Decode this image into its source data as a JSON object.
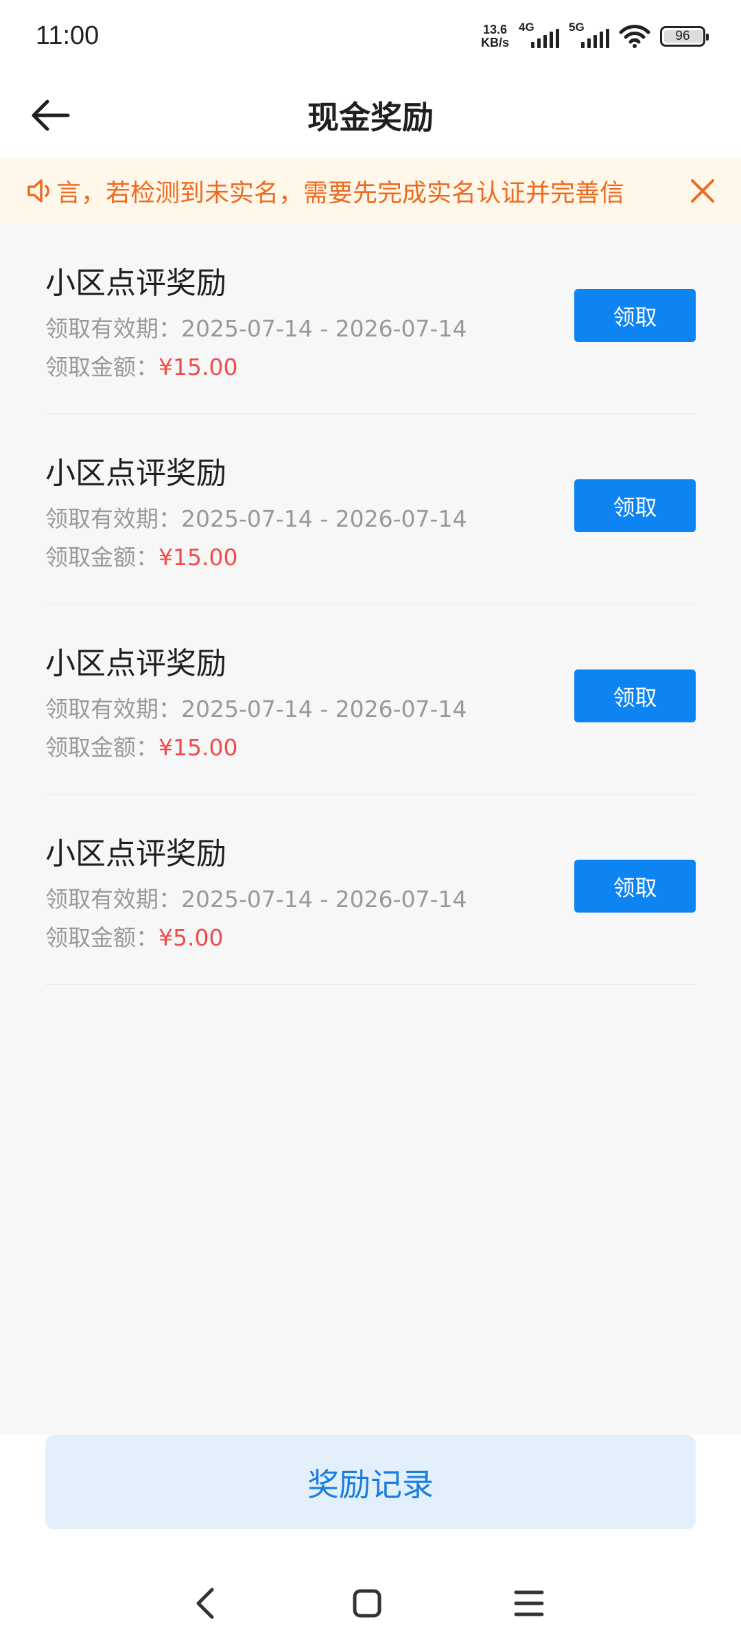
{
  "status_bar": {
    "time": "11:00",
    "net_speed_value": "13.6",
    "net_speed_unit": "KB/s",
    "sim1_label": "4G",
    "sim2_label": "5G",
    "battery_level": "96",
    "icons": [
      "signal-4g-icon",
      "signal-5g-icon",
      "wifi-icon",
      "battery-icon"
    ]
  },
  "header": {
    "title": "现金奖励",
    "back_icon": "arrow-left-icon"
  },
  "notice": {
    "icon": "speaker-icon",
    "text": "言，若检测到未实名，需要先完成实名认证并完善信",
    "close_icon": "close-icon"
  },
  "rewards": [
    {
      "title": "小区点评奖励",
      "validity_label": "领取有效期：",
      "validity": "2025-07-14 - 2026-07-14",
      "amount_label": "领取金额：",
      "amount": "¥15.00",
      "button_label": "领取"
    },
    {
      "title": "小区点评奖励",
      "validity_label": "领取有效期：",
      "validity": "2025-07-14 - 2026-07-14",
      "amount_label": "领取金额：",
      "amount": "¥15.00",
      "button_label": "领取"
    },
    {
      "title": "小区点评奖励",
      "validity_label": "领取有效期：",
      "validity": "2025-07-14 - 2026-07-14",
      "amount_label": "领取金额：",
      "amount": "¥15.00",
      "button_label": "领取"
    },
    {
      "title": "小区点评奖励",
      "validity_label": "领取有效期：",
      "validity": "2025-07-14 - 2026-07-14",
      "amount_label": "领取金额：",
      "amount": "¥5.00",
      "button_label": "领取"
    }
  ],
  "footer": {
    "records_button_label": "奖励记录"
  },
  "nav_bar": {
    "icons": [
      "nav-back-icon",
      "nav-home-icon",
      "nav-menu-icon"
    ]
  },
  "colors": {
    "accent": "#0d84f2",
    "amount": "#f04b4b",
    "notice_text": "#ee6a1f",
    "notice_bg": "#fff8ea",
    "records_bg": "#e3f0fc"
  }
}
